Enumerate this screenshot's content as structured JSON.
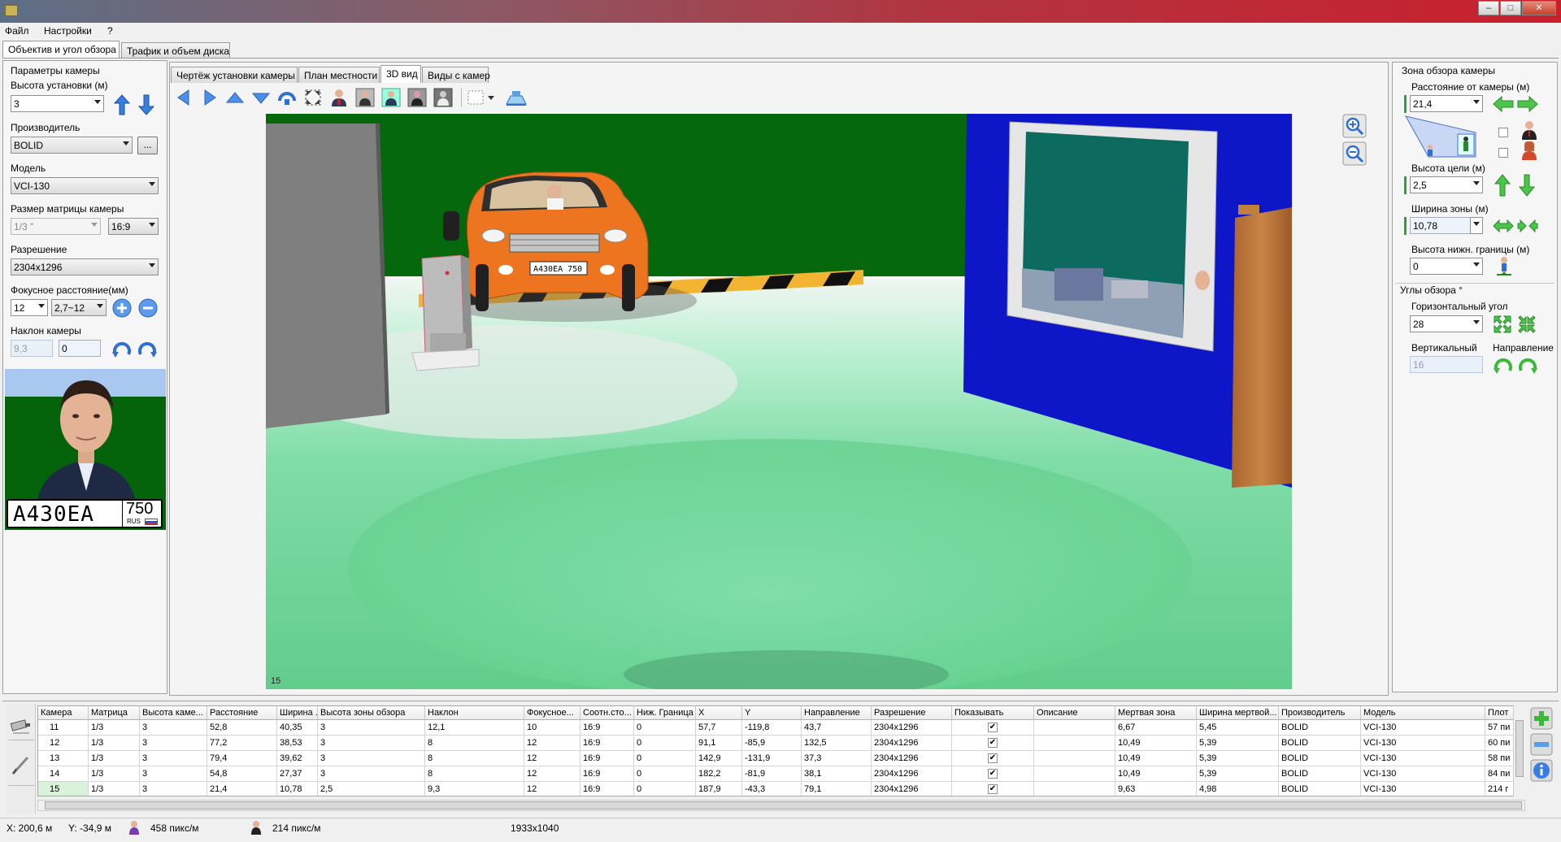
{
  "menu": [
    "Файл",
    "Настройки",
    "?"
  ],
  "main_tabs": [
    "Объектив и угол обзора",
    "Трафик и объем диска"
  ],
  "view_tabs": [
    "Чертёж установки камеры",
    "План местности",
    "3D вид",
    "Виды с камер"
  ],
  "camera_params": {
    "title": "Параметры камеры",
    "height_label": "Высота установки (м)",
    "height_value": "3",
    "vendor_label": "Производитель",
    "vendor_value": "BOLID",
    "vendor_more": "...",
    "model_label": "Модель",
    "model_value": "VCI-130",
    "matrix_label": "Размер матрицы камеры",
    "matrix_value": "1/3 \"",
    "aspect_value": "16:9",
    "resolution_label": "Разрешение",
    "resolution_value": "2304x1296",
    "focal_label": "Фокусное расстояние(мм)",
    "focal_value": "12",
    "focal_range": "2,7~12",
    "tilt_label": "Наклон камеры",
    "tilt_value": "9,3",
    "tilt_value2": "0"
  },
  "preview": {
    "plate": "А430ЕА",
    "region": "750",
    "country": "RUS"
  },
  "viewport": {
    "corner_label": "15",
    "car_plate": "А430ЕА 750"
  },
  "zone": {
    "title": "Зона обзора камеры",
    "distance_label": "Расстояние от камеры (м)",
    "distance_value": "21,4",
    "target_height_label": "Высота цели (м)",
    "target_height_value": "2,5",
    "zone_width_label": "Ширина зоны (м)",
    "zone_width_value": "10,78",
    "lower_bound_label": "Высота нижн. границы (м)",
    "lower_bound_value": "0"
  },
  "angles": {
    "title": "Углы обзора °",
    "horizontal_label": "Горизонтальный угол",
    "horizontal_value": "28",
    "vertical_label": "Вертикальный",
    "vertical_value": "16",
    "direction_label": "Направление"
  },
  "grid": {
    "columns": [
      "Камера",
      "Матрица",
      "Высота каме...",
      "Расстояние",
      "Ширина ...",
      "Высота зоны обзора",
      "Наклон",
      "Фокусное...",
      "Соотн.сто...",
      "Ниж. Граница",
      "X",
      "Y",
      "Направление",
      "Разрешение",
      "Показывать",
      "Описание",
      "Мертвая зона",
      "Ширина мертвой...",
      "Производитель",
      "Модель",
      "Плот"
    ],
    "rows": [
      [
        "11",
        "1/3",
        "3",
        "52,8",
        "40,35",
        "3",
        "12,1",
        "10",
        "16:9",
        "0",
        "57,7",
        "-119,8",
        "43,7",
        "2304x1296",
        "✔",
        "",
        "6,67",
        "5,45",
        "BOLID",
        "VCI-130",
        "57 пи"
      ],
      [
        "12",
        "1/3",
        "3",
        "77,2",
        "38,53",
        "3",
        "8",
        "12",
        "16:9",
        "0",
        "91,1",
        "-85,9",
        "132,5",
        "2304x1296",
        "✔",
        "",
        "10,49",
        "5,39",
        "BOLID",
        "VCI-130",
        "60 пи"
      ],
      [
        "13",
        "1/3",
        "3",
        "79,4",
        "39,62",
        "3",
        "8",
        "12",
        "16:9",
        "0",
        "142,9",
        "-131,9",
        "37,3",
        "2304x1296",
        "✔",
        "",
        "10,49",
        "5,39",
        "BOLID",
        "VCI-130",
        "58 пи"
      ],
      [
        "14",
        "1/3",
        "3",
        "54,8",
        "27,37",
        "3",
        "8",
        "12",
        "16:9",
        "0",
        "182,2",
        "-81,9",
        "38,1",
        "2304x1296",
        "✔",
        "",
        "10,49",
        "5,39",
        "BOLID",
        "VCI-130",
        "84 пи"
      ],
      [
        "15",
        "1/3",
        "3",
        "21,4",
        "10,78",
        "2,5",
        "9,3",
        "12",
        "16:9",
        "0",
        "187,9",
        "-43,3",
        "79,1",
        "2304x1296",
        "✔",
        "",
        "9,63",
        "4,98",
        "BOLID",
        "VCI-130",
        "214 г"
      ]
    ]
  },
  "status": {
    "x": "X: 200,6 м",
    "y": "Y: -34,9 м",
    "ppm1": "458 пикс/м",
    "ppm2": "214 пикс/м",
    "size": "1933x1040"
  },
  "colors": {
    "accent_blue": "#2f6fd1",
    "green_arrow": "#2ea043",
    "wall_blue": "#0f1fb0",
    "ground_green": "#0a6b12"
  }
}
